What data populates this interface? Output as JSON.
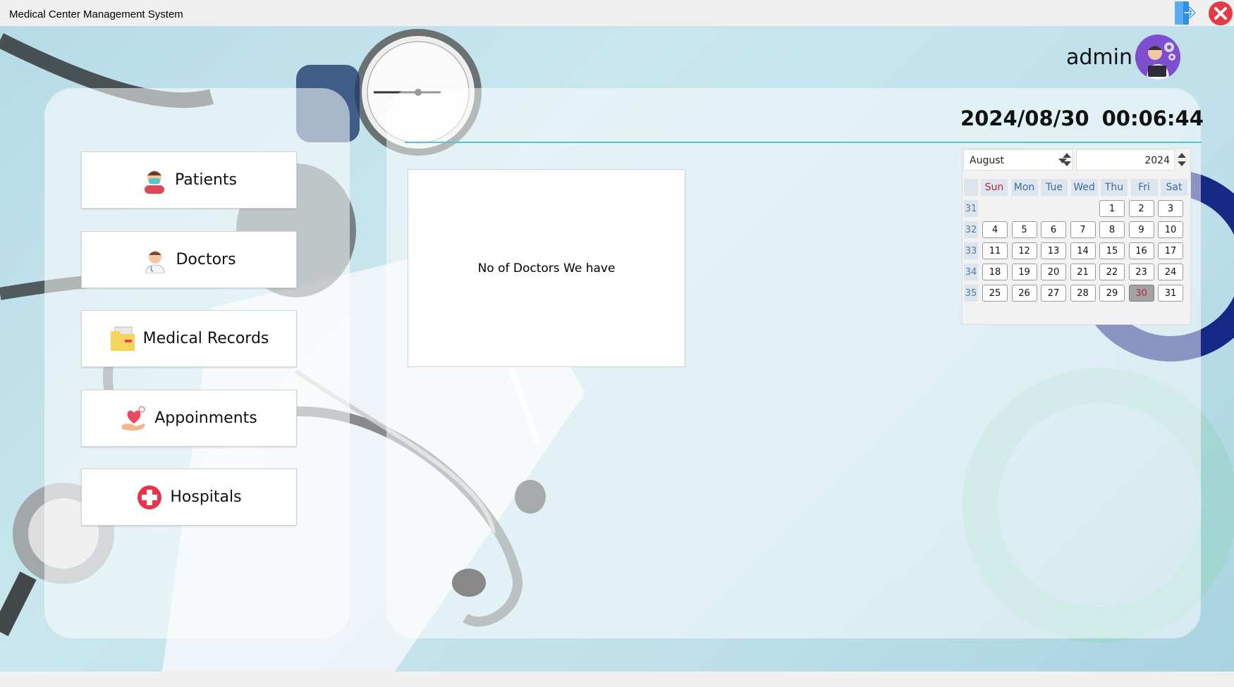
{
  "window": {
    "title": "Medical Center Management System"
  },
  "header": {
    "username": "admin",
    "date": "2024/08/30",
    "time": "00:06:44"
  },
  "nav": [
    {
      "label": "Patients",
      "icon": "patient-icon"
    },
    {
      "label": "Doctors",
      "icon": "doctor-icon"
    },
    {
      "label": "Medical Records",
      "icon": "folder-icon"
    },
    {
      "label": "Appoinments",
      "icon": "heart-hand-icon"
    },
    {
      "label": "Hospitals",
      "icon": "hospital-cross-icon"
    }
  ],
  "card": {
    "text": "No of Doctors We have"
  },
  "calendar": {
    "month": "August",
    "year": "2024",
    "day_headers": [
      "Sun",
      "Mon",
      "Tue",
      "Wed",
      "Thu",
      "Fri",
      "Sat"
    ],
    "weeks": [
      {
        "number": "31",
        "days": [
          "",
          "",
          "",
          "",
          "1",
          "2",
          "3"
        ]
      },
      {
        "number": "32",
        "days": [
          "4",
          "5",
          "6",
          "7",
          "8",
          "9",
          "10"
        ]
      },
      {
        "number": "33",
        "days": [
          "11",
          "12",
          "13",
          "14",
          "15",
          "16",
          "17"
        ]
      },
      {
        "number": "34",
        "days": [
          "18",
          "19",
          "20",
          "21",
          "22",
          "23",
          "24"
        ]
      },
      {
        "number": "35",
        "days": [
          "25",
          "26",
          "27",
          "28",
          "29",
          "30",
          "31"
        ]
      }
    ],
    "selected_day": "30"
  },
  "colors": {
    "accent_line": "#55c3c9",
    "avatar_bg": "#7d4fd0",
    "close_red": "#e53945",
    "logout_blue": "#2f8fe0"
  }
}
